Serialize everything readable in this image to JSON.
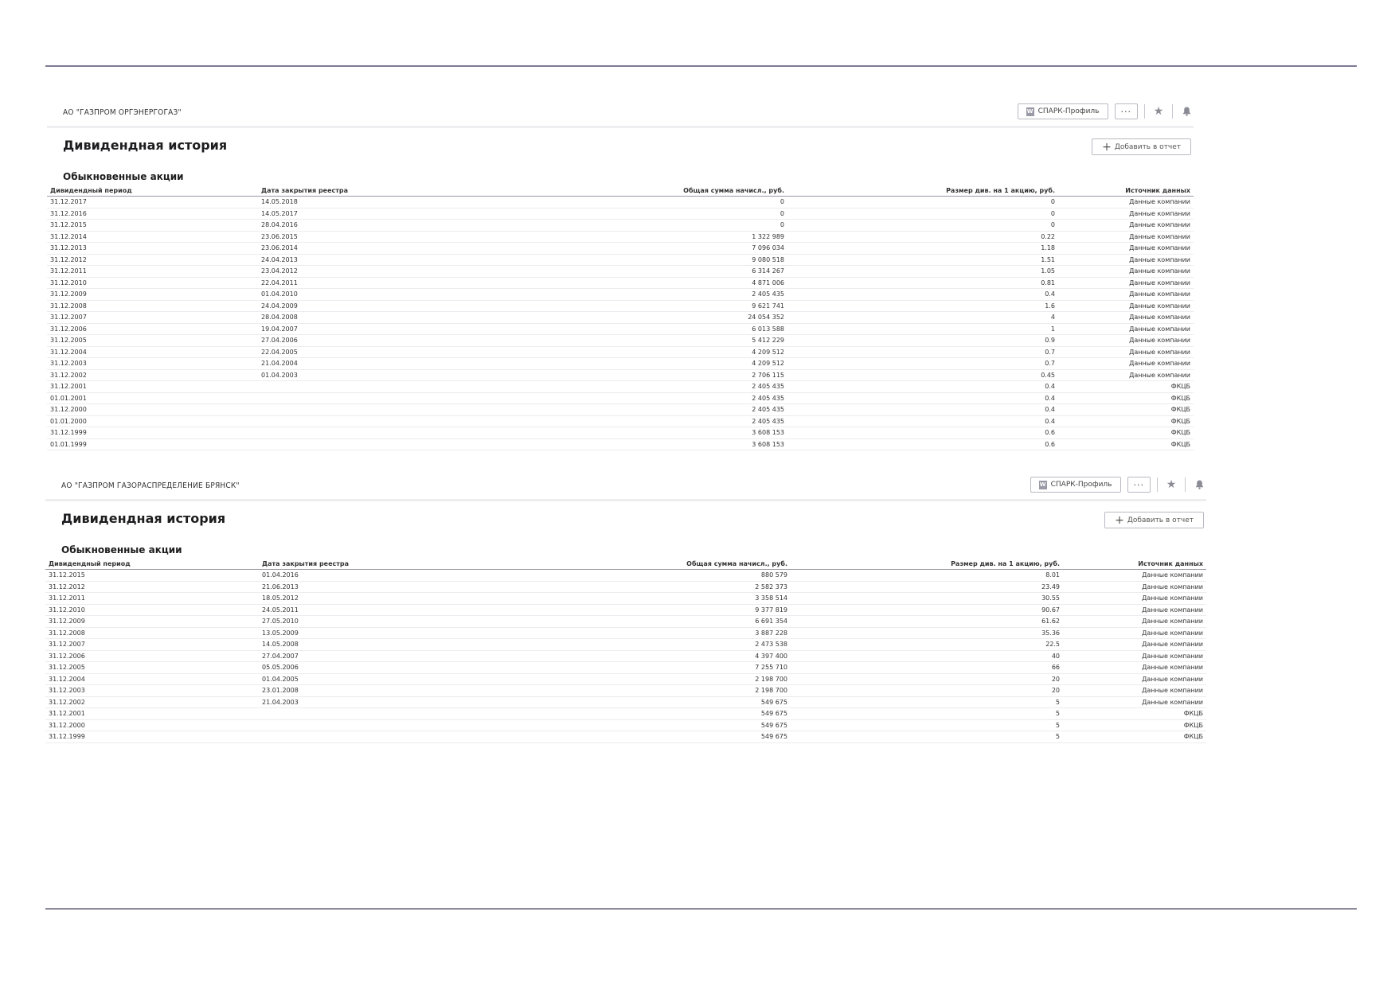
{
  "panels": [
    {
      "company_name": "АО \"ГАЗПРОМ ОРГЭНЕРГОГАЗ\"",
      "spark_button": "СПАРК-Профиль",
      "spark_icon_glyph": "W",
      "more_glyph": "···",
      "star_glyph": "★",
      "bell_glyph": "🔔",
      "title": "Дивидендная история",
      "add_button": "Добавить в отчет",
      "plus_glyph": "+",
      "section_title": "Обыкновенные акции",
      "columns": [
        "Дивидендный период",
        "Дата закрытия реестра",
        "Общая сумма начисл., руб.",
        "Размер див. на 1 акцию, руб.",
        "Источник данных"
      ],
      "rows": [
        [
          "31.12.2017",
          "14.05.2018",
          "0",
          "0",
          "Данные компании"
        ],
        [
          "31.12.2016",
          "14.05.2017",
          "0",
          "0",
          "Данные компании"
        ],
        [
          "31.12.2015",
          "28.04.2016",
          "0",
          "0",
          "Данные компании"
        ],
        [
          "31.12.2014",
          "23.06.2015",
          "1 322 989",
          "0.22",
          "Данные компании"
        ],
        [
          "31.12.2013",
          "23.06.2014",
          "7 096 034",
          "1.18",
          "Данные компании"
        ],
        [
          "31.12.2012",
          "24.04.2013",
          "9 080 518",
          "1.51",
          "Данные компании"
        ],
        [
          "31.12.2011",
          "23.04.2012",
          "6 314 267",
          "1.05",
          "Данные компании"
        ],
        [
          "31.12.2010",
          "22.04.2011",
          "4 871 006",
          "0.81",
          "Данные компании"
        ],
        [
          "31.12.2009",
          "01.04.2010",
          "2 405 435",
          "0.4",
          "Данные компании"
        ],
        [
          "31.12.2008",
          "24.04.2009",
          "9 621 741",
          "1.6",
          "Данные компании"
        ],
        [
          "31.12.2007",
          "28.04.2008",
          "24 054 352",
          "4",
          "Данные компании"
        ],
        [
          "31.12.2006",
          "19.04.2007",
          "6 013 588",
          "1",
          "Данные компании"
        ],
        [
          "31.12.2005",
          "27.04.2006",
          "5 412 229",
          "0.9",
          "Данные компании"
        ],
        [
          "31.12.2004",
          "22.04.2005",
          "4 209 512",
          "0.7",
          "Данные компании"
        ],
        [
          "31.12.2003",
          "21.04.2004",
          "4 209 512",
          "0.7",
          "Данные компании"
        ],
        [
          "31.12.2002",
          "01.04.2003",
          "2 706 115",
          "0.45",
          "Данные компании"
        ],
        [
          "31.12.2001",
          "",
          "2 405 435",
          "0.4",
          "ФКЦБ"
        ],
        [
          "01.01.2001",
          "",
          "2 405 435",
          "0.4",
          "ФКЦБ"
        ],
        [
          "31.12.2000",
          "",
          "2 405 435",
          "0.4",
          "ФКЦБ"
        ],
        [
          "01.01.2000",
          "",
          "2 405 435",
          "0.4",
          "ФКЦБ"
        ],
        [
          "31.12.1999",
          "",
          "3 608 153",
          "0.6",
          "ФКЦБ"
        ],
        [
          "01.01.1999",
          "",
          "3 608 153",
          "0.6",
          "ФКЦБ"
        ]
      ]
    },
    {
      "company_name": "АО \"ГАЗПРОМ ГАЗОРАСПРЕДЕЛЕНИЕ БРЯНСК\"",
      "spark_button": "СПАРК-Профиль",
      "spark_icon_glyph": "W",
      "more_glyph": "···",
      "star_glyph": "★",
      "bell_glyph": "🔔",
      "title": "Дивидендная история",
      "add_button": "Добавить в отчет",
      "plus_glyph": "+",
      "section_title": "Обыкновенные акции",
      "columns": [
        "Дивидендный период",
        "Дата закрытия реестра",
        "Общая сумма начисл., руб.",
        "Размер див. на 1 акцию, руб.",
        "Источник данных"
      ],
      "rows": [
        [
          "31.12.2015",
          "01.04.2016",
          "880 579",
          "8.01",
          "Данные компании"
        ],
        [
          "31.12.2012",
          "21.06.2013",
          "2 582 373",
          "23.49",
          "Данные компании"
        ],
        [
          "31.12.2011",
          "18.05.2012",
          "3 358 514",
          "30.55",
          "Данные компании"
        ],
        [
          "31.12.2010",
          "24.05.2011",
          "9 377 819",
          "90.67",
          "Данные компании"
        ],
        [
          "31.12.2009",
          "27.05.2010",
          "6 691 354",
          "61.62",
          "Данные компании"
        ],
        [
          "31.12.2008",
          "13.05.2009",
          "3 887 228",
          "35.36",
          "Данные компании"
        ],
        [
          "31.12.2007",
          "14.05.2008",
          "2 473 538",
          "22.5",
          "Данные компании"
        ],
        [
          "31.12.2006",
          "27.04.2007",
          "4 397 400",
          "40",
          "Данные компании"
        ],
        [
          "31.12.2005",
          "05.05.2006",
          "7 255 710",
          "66",
          "Данные компании"
        ],
        [
          "31.12.2004",
          "01.04.2005",
          "2 198 700",
          "20",
          "Данные компании"
        ],
        [
          "31.12.2003",
          "23.01.2008",
          "2 198 700",
          "20",
          "Данные компании"
        ],
        [
          "31.12.2002",
          "21.04.2003",
          "549 675",
          "5",
          "Данные компании"
        ],
        [
          "31.12.2001",
          "",
          "549 675",
          "5",
          "ФКЦБ"
        ],
        [
          "31.12.2000",
          "",
          "549 675",
          "5",
          "ФКЦБ"
        ],
        [
          "31.12.1999",
          "",
          "549 675",
          "5",
          "ФКЦБ"
        ]
      ]
    }
  ]
}
